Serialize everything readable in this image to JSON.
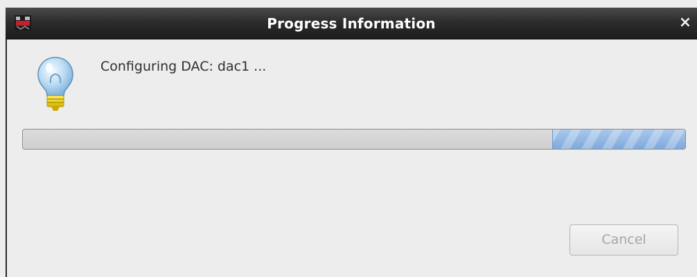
{
  "window": {
    "title": "Progress Information",
    "close_glyph": "×",
    "app_icon": "app-logo-icon"
  },
  "content": {
    "icon": "lightbulb-icon",
    "message": "Configuring DAC: dac1 ..."
  },
  "progress": {
    "indeterminate": true,
    "fill_fraction": 0.2,
    "fill_color": "#7fa9da"
  },
  "buttons": {
    "cancel_label": "Cancel",
    "cancel_enabled": false
  }
}
